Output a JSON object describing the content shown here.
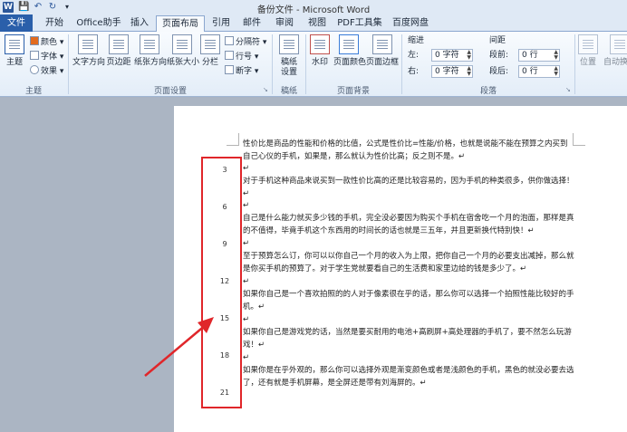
{
  "window": {
    "title": "备份文件 - Microsoft Word",
    "app_icon": "W"
  },
  "quick_access": [
    "save-icon",
    "undo-icon",
    "redo-icon",
    "customize-icon"
  ],
  "tabs": [
    {
      "label": "文件"
    },
    {
      "label": "开始"
    },
    {
      "label": "Office助手"
    },
    {
      "label": "插入"
    },
    {
      "label": "页面布局"
    },
    {
      "label": "引用"
    },
    {
      "label": "邮件"
    },
    {
      "label": "审阅"
    },
    {
      "label": "视图"
    },
    {
      "label": "PDF工具集"
    },
    {
      "label": "百度网盘"
    }
  ],
  "active_tab": "页面布局",
  "ribbon": {
    "theme": {
      "big": "主题",
      "colors": "颜色",
      "fonts": "字体",
      "effects": "效果",
      "group": "主题"
    },
    "page_setup": {
      "text_direction": "文字方向",
      "margins": "页边距",
      "orientation": "纸张方向",
      "size": "纸张大小",
      "columns": "分栏",
      "breaks": "分隔符",
      "line_numbers": "行号",
      "hyphenation": "断字",
      "group": "页面设置"
    },
    "draft": {
      "btn": "稿纸\n设置",
      "group": "稿纸"
    },
    "page_background": {
      "watermark": "水印",
      "page_color": "页面颜色",
      "page_borders": "页面边框",
      "group": "页面背景"
    },
    "paragraph": {
      "indent_title": "缩进",
      "spacing_title": "间距",
      "left_label": "左:",
      "left_value": "0 字符",
      "right_label": "右:",
      "right_value": "0 字符",
      "before_label": "段前:",
      "before_value": "0 行",
      "after_label": "段后:",
      "after_value": "0 行",
      "group": "段落"
    },
    "arrange": {
      "position": "位置",
      "wrap": "自动换行"
    }
  },
  "document": {
    "paragraphs": [
      "性价比是商品的性能和价格的比值，公式是性价比=性能/价格，也就是说能不能在预算之内买到自己心仪的手机，如果是，那么就认为性价比高；反之则不是。↵",
      "↵",
      "对于手机这种商品来说买到一款性价比高的还是比较容易的，因为手机的种类很多，供你做选择！↵",
      "↵",
      "自己是什么能力就买多少钱的手机，完全没必要因为购买个手机在宿舍吃一个月的泡面，那样是真的不值得，毕竟手机这个东西用的时间长的话也就是三五年，并且更新换代特别快！↵",
      "↵",
      "至于预算怎么订，你可以以你自己一个月的收入为上限，把你自己一个月的必要支出减掉，那么就是你买手机的预算了。对于学生党就要看自己的生活费和家里边给的钱是多少了。↵",
      "↵",
      "如果你自己是一个喜欢拍照的的人对于像素很在乎的话，那么你可以选择一个拍照性能比较好的手机。↵",
      "↵",
      "如果你自己是游戏党的话，当然是要买耐用的电池+高刷屏+高处理器的手机了，要不然怎么玩游戏！↵",
      "↵",
      "如果你是在乎外观的，那么你可以选择外观是渐变颜色或者是浅颜色的手机，黑色的就没必要去选了，还有就是手机屏幕，是全屏还是带有刘海屏的。↵"
    ],
    "line_numbers": [
      "3",
      "6",
      "9",
      "12",
      "15",
      "18",
      "21"
    ],
    "annotation_color": "#e0262a"
  }
}
